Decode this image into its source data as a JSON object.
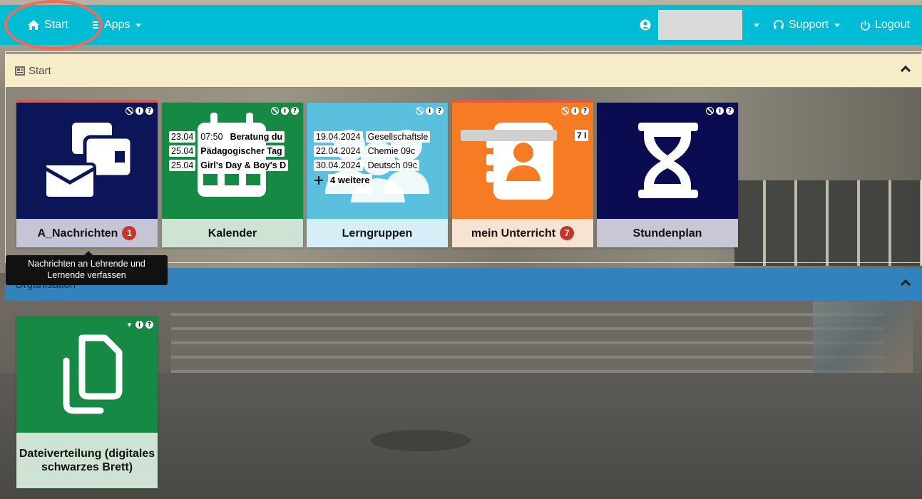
{
  "topbar": {
    "start": "Start",
    "apps": "Apps",
    "support": "Support",
    "logout": "Logout",
    "bg_color": "#00bcd4"
  },
  "panels": {
    "start_title": "Start",
    "org_title": "Organisation"
  },
  "tiles": {
    "nachrichten": {
      "label": "A_Nachrichten",
      "badge": "1",
      "icon": "envelope-icon"
    },
    "kalender": {
      "label": "Kalender",
      "events": [
        {
          "date": "23.04",
          "time": "07:50",
          "title": "Beratung du"
        },
        {
          "date": "25.04",
          "title": "Pädagogischer Tag"
        },
        {
          "date": "25.04",
          "title": "Girl's Day & Boy's D"
        }
      ]
    },
    "lerngruppen": {
      "label": "Lerngruppen",
      "entries": [
        {
          "date": "19.04.2024",
          "subject": "Gesellschaftsle"
        },
        {
          "date": "22.04.2024",
          "subject": "Chemie 09c"
        },
        {
          "date": "30.04.2024",
          "subject": "Deutsch 09c"
        }
      ],
      "more": "4 weitere"
    },
    "unterricht": {
      "label": "mein Unterricht",
      "badge": "7",
      "chip": "7 I"
    },
    "stundenplan": {
      "label": "Stundenplan",
      "icon": "hourglass-icon"
    },
    "datei": {
      "label": "Dateiverteilung (digitales schwarzes Brett)",
      "icon": "copy-icon"
    }
  },
  "tooltip": "Nachrichten an Lehrende und Lernende verfassen"
}
